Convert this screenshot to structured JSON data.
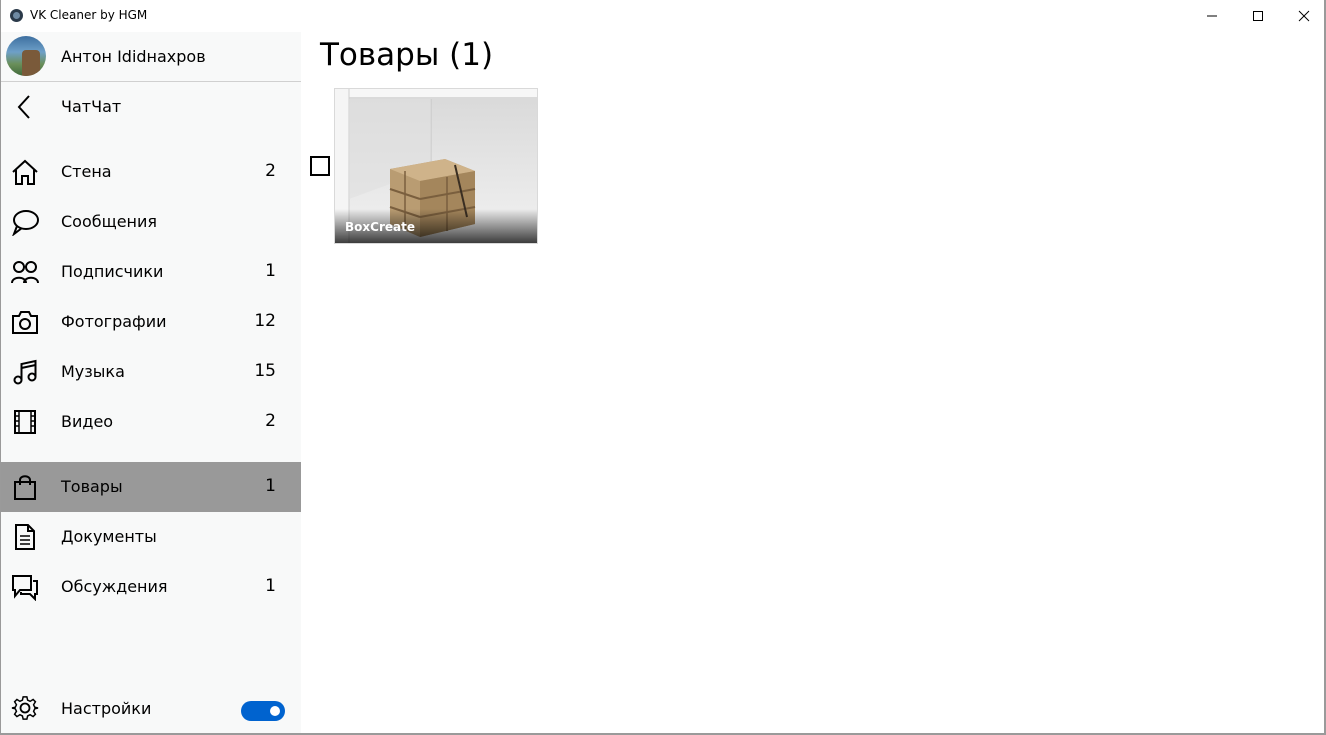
{
  "window": {
    "title": "VK Cleaner by HGM",
    "icon": "app-logo-icon",
    "controls": [
      "minimize-icon",
      "maximize-icon",
      "close-icon"
    ]
  },
  "profile": {
    "name": "Антон Ididнахров"
  },
  "back": {
    "label": "ЧатЧат",
    "icon": "back-arrow-icon"
  },
  "nav": {
    "items": [
      {
        "id": "wall",
        "label": "Стена",
        "count": "2",
        "icon": "home-icon"
      },
      {
        "id": "messages",
        "label": "Сообщения",
        "count": "",
        "icon": "chat-bubble-icon"
      },
      {
        "id": "followers",
        "label": "Подписчики",
        "count": "1",
        "icon": "people-icon"
      },
      {
        "id": "photos",
        "label": "Фотографии",
        "count": "12",
        "icon": "camera-icon"
      },
      {
        "id": "music",
        "label": "Музыка",
        "count": "15",
        "icon": "music-note-icon"
      },
      {
        "id": "video",
        "label": "Видео",
        "count": "2",
        "icon": "film-icon"
      },
      {
        "id": "goods",
        "label": "Товары",
        "count": "1",
        "icon": "shopping-bag-icon",
        "active": true
      },
      {
        "id": "docs",
        "label": "Документы",
        "count": "",
        "icon": "document-icon"
      },
      {
        "id": "discussions",
        "label": "Обсуждения",
        "count": "1",
        "icon": "discussion-icon"
      }
    ]
  },
  "settings": {
    "label": "Настройки",
    "icon": "gear-icon",
    "toggle_on": true
  },
  "main": {
    "title": "Товары (1)",
    "products": [
      {
        "name": "BoxCreate",
        "selected": false
      }
    ]
  },
  "colors": {
    "active_item": "#999999",
    "sidebar_bg": "#f8f9f9",
    "toggle_accent": "#0063cf"
  }
}
